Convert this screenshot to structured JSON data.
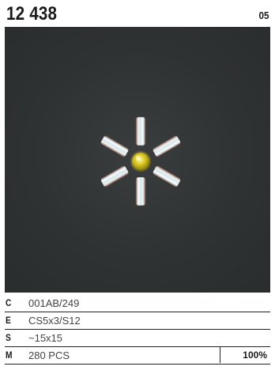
{
  "header": {
    "code": "12 438",
    "page": "05"
  },
  "photo": {
    "icon": "rhinestone-flower-motif",
    "stone_color": "#d8c820"
  },
  "specs": [
    {
      "key": "C",
      "value": "001AB/249"
    },
    {
      "key": "E",
      "value": "CS5x3/S12"
    },
    {
      "key": "S",
      "value": "~15x15"
    },
    {
      "key": "M",
      "value": "280 PCS",
      "extra": "100%"
    }
  ]
}
